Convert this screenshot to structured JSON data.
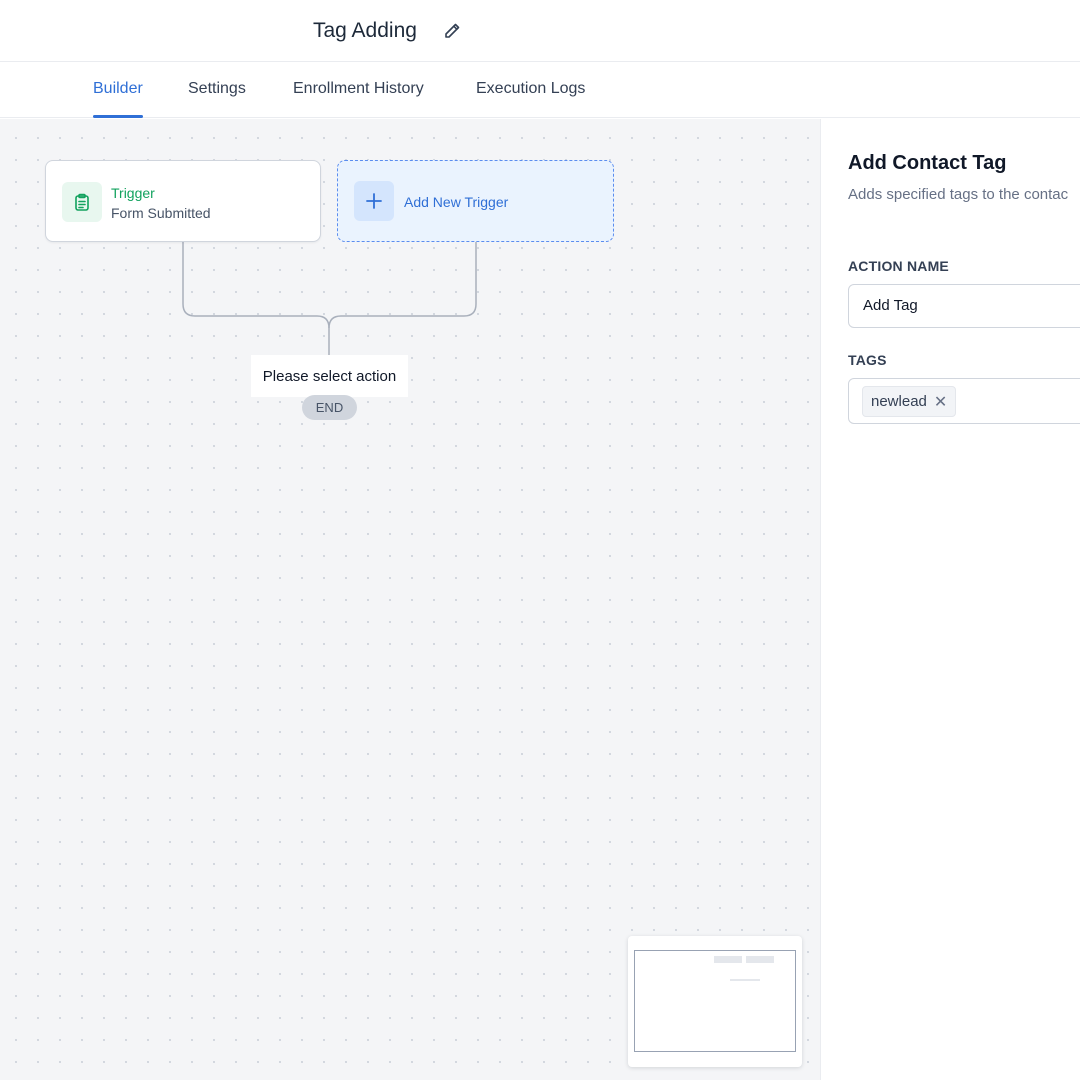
{
  "header": {
    "title": "Tag Adding"
  },
  "tabs": [
    {
      "label": "Builder",
      "active": true
    },
    {
      "label": "Settings",
      "active": false
    },
    {
      "label": "Enrollment History",
      "active": false
    },
    {
      "label": "Execution Logs",
      "active": false
    }
  ],
  "canvas": {
    "trigger_node": {
      "title": "Trigger",
      "subtitle": "Form Submitted",
      "icon": "clipboard-icon"
    },
    "add_trigger_node": {
      "label": "Add New Trigger",
      "icon": "plus-icon"
    },
    "action_placeholder": "Please select action",
    "end_label": "END"
  },
  "panel": {
    "title": "Add Contact Tag",
    "description": "Adds specified tags to the contac",
    "action_name_label": "ACTION NAME",
    "action_name_value": "Add Tag",
    "tags_label": "TAGS",
    "tags": [
      "newlead"
    ]
  },
  "colors": {
    "accent": "#2f6fd6",
    "trigger_green": "#12a25e",
    "canvas_bg": "#f4f5f7"
  }
}
